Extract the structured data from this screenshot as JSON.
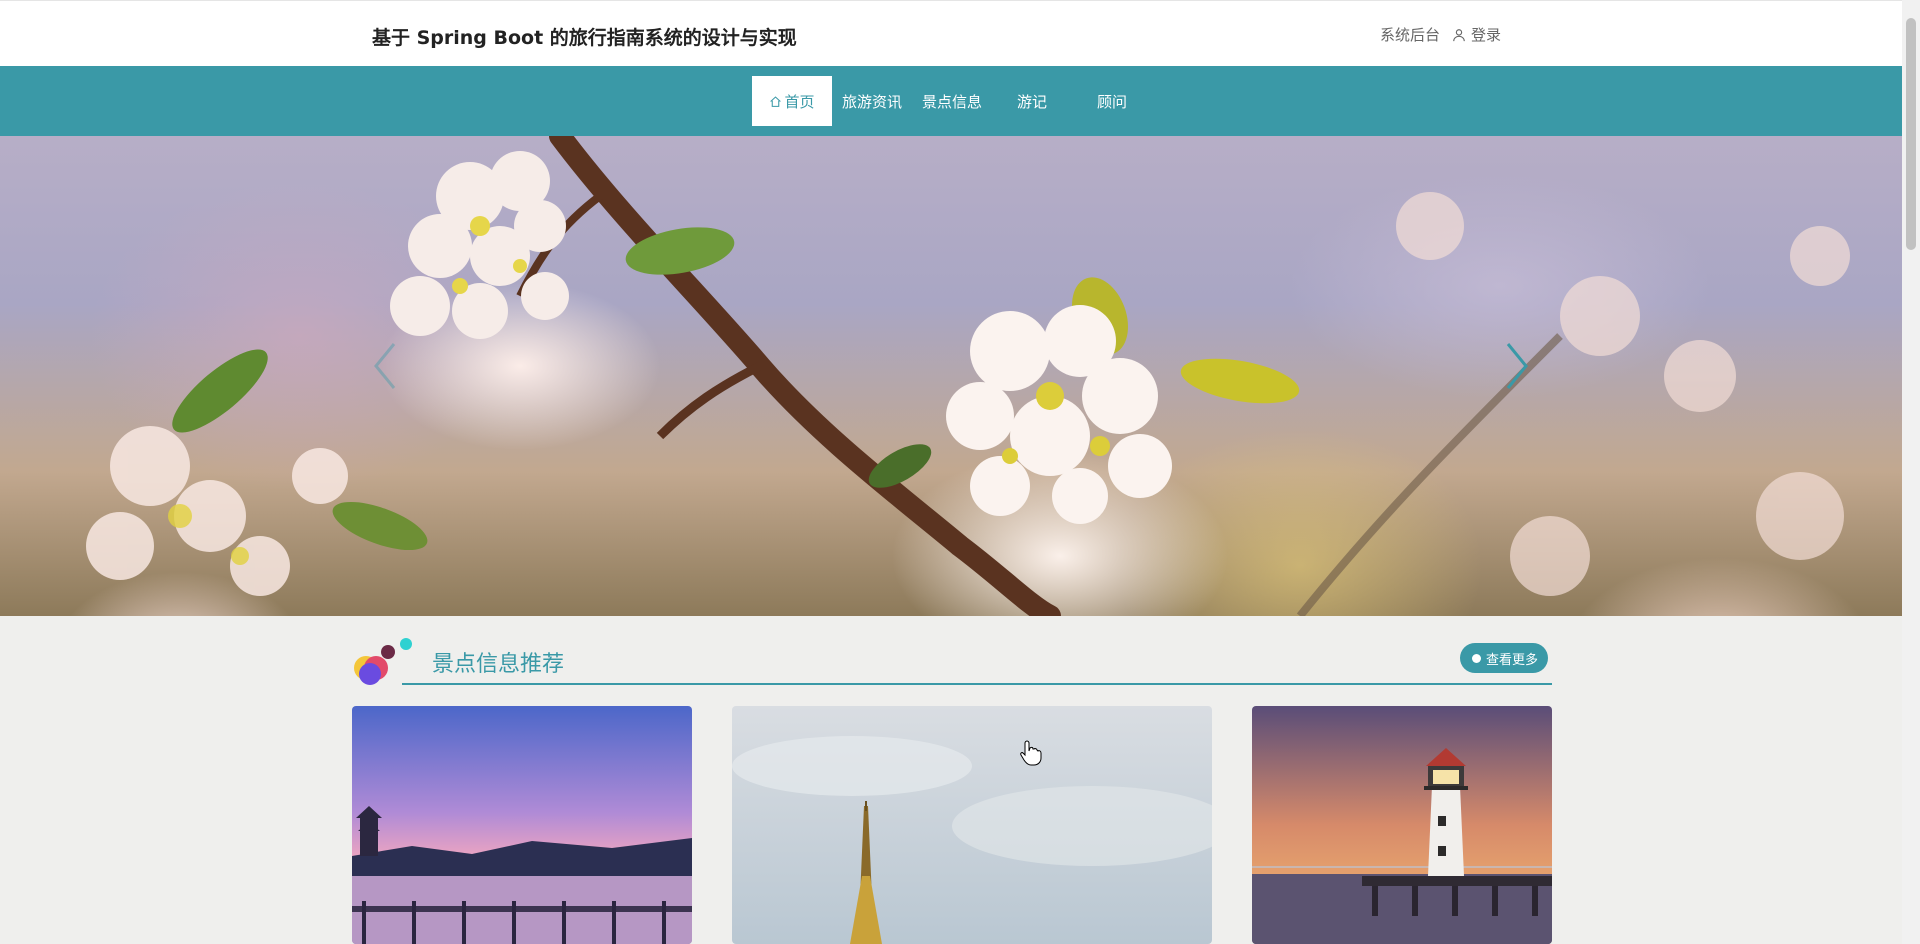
{
  "header": {
    "site_title": "基于 Spring Boot 的旅行指南系统的设计与实现",
    "admin_link": "系统后台",
    "login_label": "登录"
  },
  "nav": {
    "items": [
      {
        "label": "首页",
        "active": true,
        "icon": "home-icon"
      },
      {
        "label": "旅游资讯",
        "active": false
      },
      {
        "label": "景点信息",
        "active": false
      },
      {
        "label": "游记",
        "active": false
      },
      {
        "label": "顾问",
        "active": false
      }
    ]
  },
  "banner": {
    "image_subject": "blossoming branch with white-pink flowers",
    "prev_icon": "chevron-left-icon",
    "next_icon": "chevron-right-icon"
  },
  "section": {
    "title": "景点信息推荐",
    "more_label": "查看更多"
  },
  "cards": [
    {
      "image_subject": "lake pagoda at sunset with wooden pier"
    },
    {
      "image_subject": "golden spire under cloudy sky"
    },
    {
      "image_subject": "lighthouse on pier at sunset"
    }
  ],
  "colors": {
    "accent": "#3a99a7",
    "background": "#efefed",
    "header_bg": "#ffffff"
  }
}
